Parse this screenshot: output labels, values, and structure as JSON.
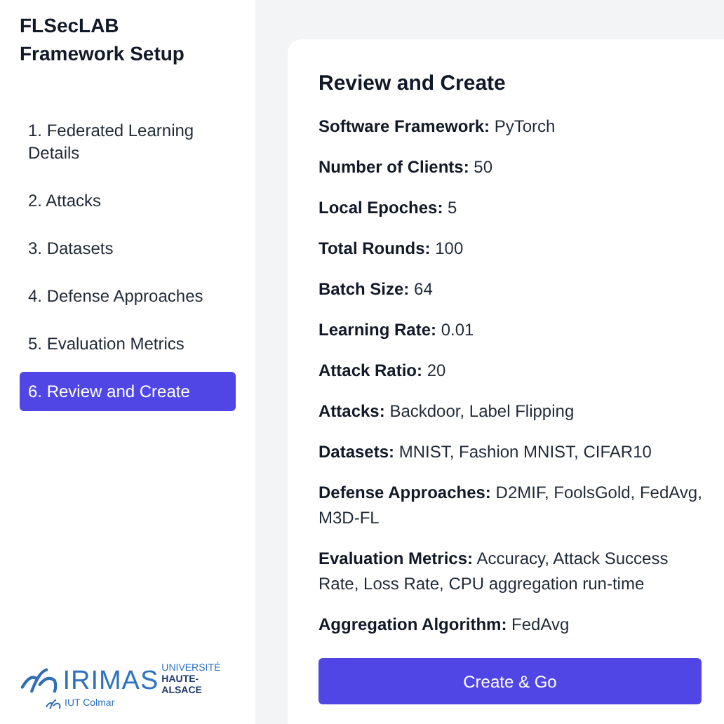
{
  "sidebar": {
    "title": "FLSecLAB Framework Setup",
    "items": [
      {
        "label": "1. Federated Learning Details",
        "selected": false
      },
      {
        "label": "2. Attacks",
        "selected": false
      },
      {
        "label": "3. Datasets",
        "selected": false
      },
      {
        "label": "4. Defense Approaches",
        "selected": false
      },
      {
        "label": "5. Evaluation Metrics",
        "selected": false
      },
      {
        "label": "6. Review and Create",
        "selected": true
      }
    ],
    "logo": {
      "name": "IRIMAS",
      "university_top": "UNIVERSITÉ",
      "university_bottom": "HAUTE-ALSACE",
      "school": "IUT Colmar"
    }
  },
  "review": {
    "title": "Review and Create",
    "fields": [
      {
        "label": "Software Framework:",
        "value": "PyTorch"
      },
      {
        "label": "Number of Clients:",
        "value": "50"
      },
      {
        "label": "Local Epoches:",
        "value": "5"
      },
      {
        "label": "Total Rounds:",
        "value": "100"
      },
      {
        "label": "Batch Size:",
        "value": "64"
      },
      {
        "label": "Learning Rate:",
        "value": "0.01"
      },
      {
        "label": "Attack Ratio:",
        "value": "20"
      },
      {
        "label": "Attacks:",
        "value": "Backdoor, Label Flipping"
      },
      {
        "label": "Datasets:",
        "value": "MNIST, Fashion MNIST, CIFAR10"
      },
      {
        "label": "Defense Approaches:",
        "value": "D2MIF, FoolsGold, FedAvg, M3D-FL"
      },
      {
        "label": "Evaluation Metrics:",
        "value": "Accuracy, Attack Success Rate, Loss Rate, CPU aggregation run-time"
      },
      {
        "label": "Aggregation Algorithm:",
        "value": "FedAvg"
      }
    ],
    "button": "Create & Go"
  }
}
